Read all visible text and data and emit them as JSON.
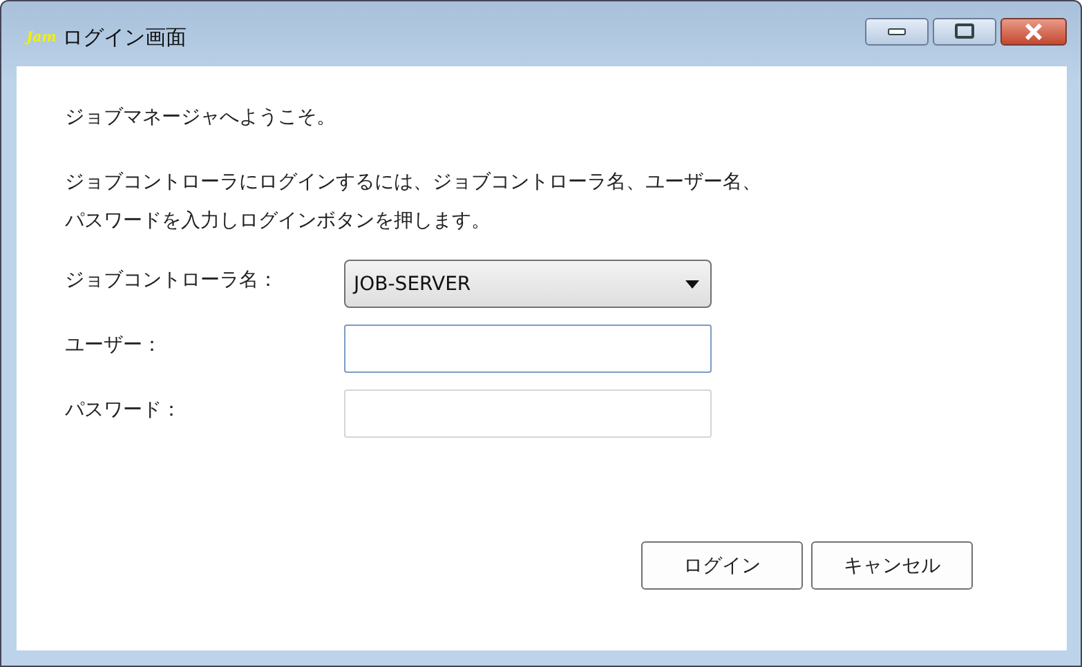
{
  "window": {
    "logo": "Jam",
    "title": "ログイン画面"
  },
  "welcome": "ジョブマネージャへようこそ。",
  "instructions": [
    "ジョブコントローラにログインするには、ジョブコントローラ名、ユーザー名、",
    "パスワードを入力しログインボタンを押します。"
  ],
  "fields": [
    {
      "kind": "dropdown",
      "label": "ジョブコントローラ名：",
      "value": "JOB-SERVER",
      "focused": false
    },
    {
      "kind": "text",
      "label": "ユーザー：",
      "focused": true
    },
    {
      "kind": "password",
      "label": "パスワード：",
      "focused": false
    }
  ],
  "buttons": [
    "ログイン",
    "キャンセル"
  ]
}
